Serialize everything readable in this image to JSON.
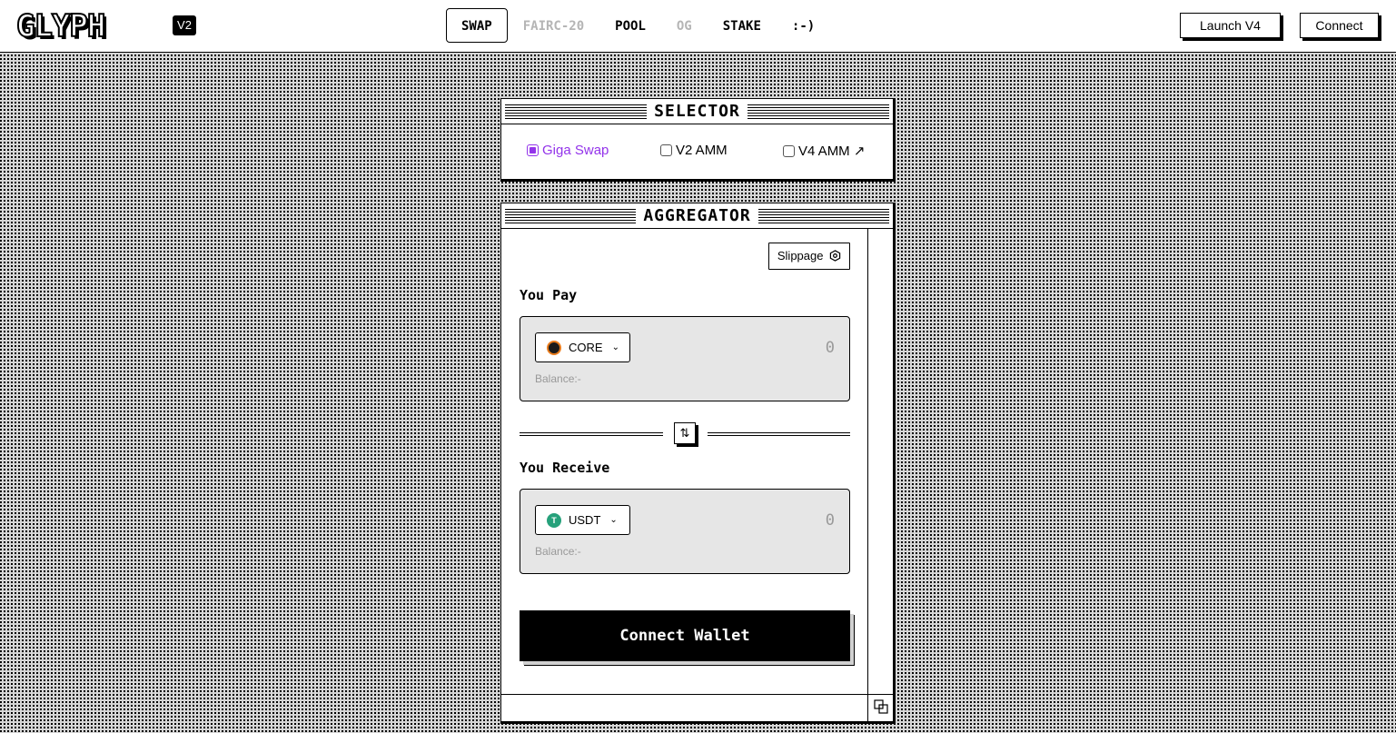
{
  "header": {
    "logo": "GLYPH",
    "version_badge": "V2",
    "nav": [
      {
        "label": "SWAP",
        "state": "active"
      },
      {
        "label": "FAIRC-20",
        "state": "disabled"
      },
      {
        "label": "POOL",
        "state": "normal"
      },
      {
        "label": "OG",
        "state": "disabled"
      },
      {
        "label": "STAKE",
        "state": "normal"
      },
      {
        "label": ":-)",
        "state": "normal"
      }
    ],
    "launch_label": "Launch V4",
    "connect_label": "Connect"
  },
  "selector": {
    "title": "SELECTOR",
    "options": [
      {
        "label": "Giga Swap",
        "checked": true
      },
      {
        "label": "V2 AMM",
        "checked": false
      },
      {
        "label": "V4 AMM ↗",
        "checked": false
      }
    ],
    "accent_color": "#9333ea"
  },
  "aggregator": {
    "title": "AGGREGATOR",
    "slippage_label": "Slippage",
    "slippage_icon": "hexagon-gear-icon",
    "pay": {
      "label": "You Pay",
      "token": "CORE",
      "token_icon_color": "#e87b1c",
      "amount": "0",
      "balance": "Balance:-"
    },
    "swap_icon": "⇅",
    "receive": {
      "label": "You Receive",
      "token": "USDT",
      "token_icon_color": "#26a17b",
      "amount": "0",
      "balance": "Balance:-"
    },
    "connect_wallet_label": "Connect Wallet"
  }
}
